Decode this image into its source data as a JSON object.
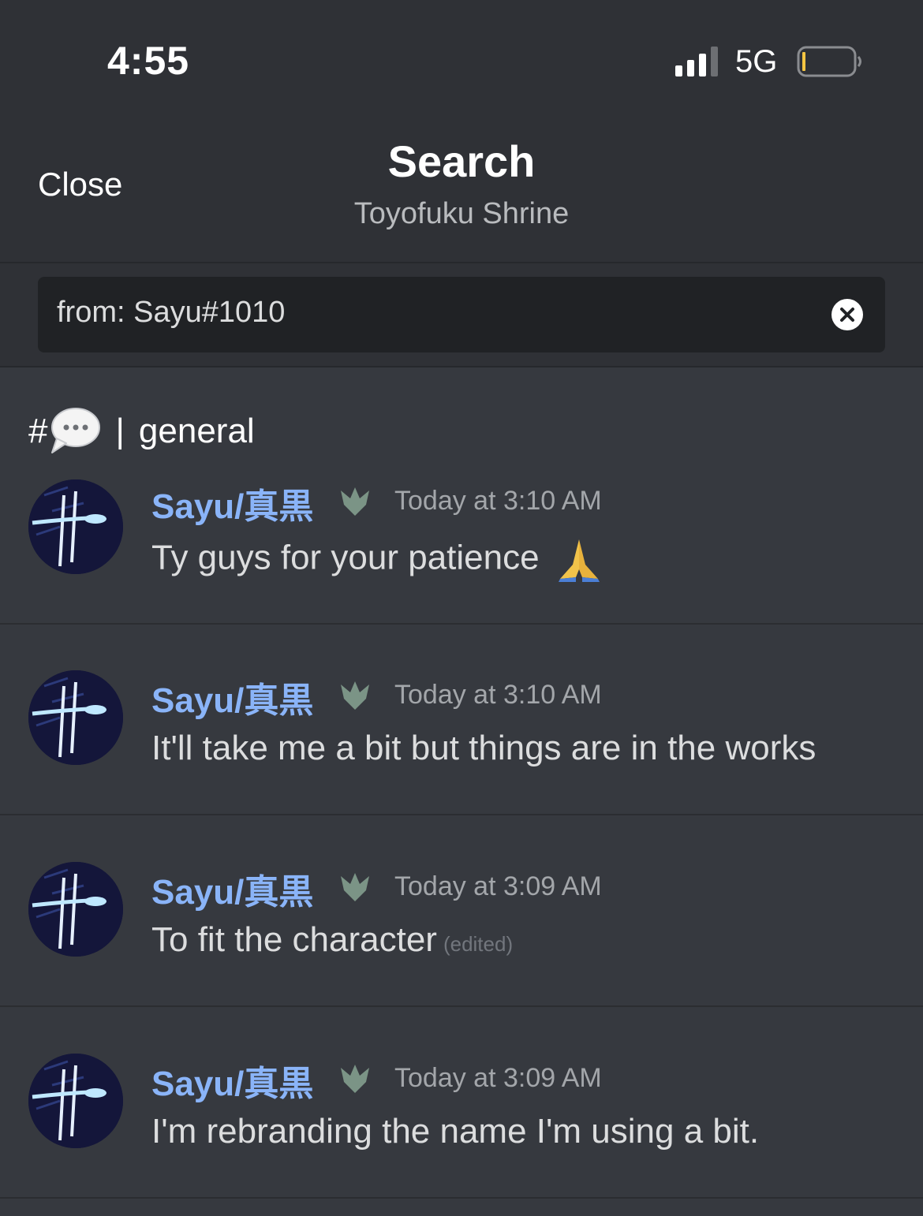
{
  "status_bar": {
    "time": "4:55",
    "network": "5G",
    "icons": [
      "signal-icon",
      "battery-icon"
    ]
  },
  "header": {
    "close_label": "Close",
    "title": "Search",
    "subtitle": "Toyofuku Shrine"
  },
  "search": {
    "query": "from: Sayu#1010",
    "clear_icon": "clear-icon"
  },
  "channel": {
    "hash": "#",
    "icon": "speech-bubble-icon",
    "separator": "|",
    "name": "general"
  },
  "messages": [
    {
      "author": "Sayu/真黒",
      "timestamp": "Today at 3:10 AM",
      "text": "Ty guys for your patience",
      "emoji": "folded-hands-icon"
    },
    {
      "author": "Sayu/真黒",
      "timestamp": "Today at 3:10 AM",
      "text": "It'll take me a bit but things are in the works"
    },
    {
      "author": "Sayu/真黒",
      "timestamp": "Today at 3:09 AM",
      "text": "To fit the character",
      "edited": "(edited)"
    },
    {
      "author": "Sayu/真黒",
      "timestamp": "Today at 3:09 AM",
      "text": "I'm rebranding the name I'm using a bit."
    }
  ],
  "colors": {
    "background": "#36393f",
    "header_bg": "#2f3136",
    "input_bg": "#202225",
    "author": "#8ab4f8",
    "timestamp": "#a3a6aa"
  }
}
